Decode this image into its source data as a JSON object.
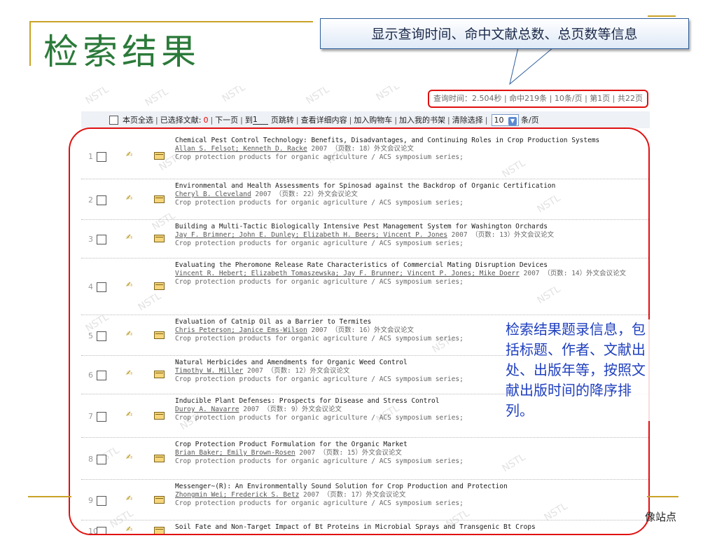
{
  "slide": {
    "title": "检索结果",
    "callout": "显示查询时间、命中文献总数、总页数等信息",
    "annotation": "检索结果题录信息，包括标题、作者、文献出处、出版年等，按照文献出版时间的降序排列。",
    "footer_fragment": "像站点",
    "accent_color": "#c9a227",
    "title_color": "#2b7a3a",
    "frame_color": "#e01010"
  },
  "status": {
    "query_time": "查询时间：2.504秒",
    "hits": "命中219条",
    "per_page": "10条/页",
    "current_page": "第1页",
    "total_pages": "共22页"
  },
  "toolbar": {
    "select_all": "本页全选",
    "selected_label": "已选择文献:",
    "selected_count": "0",
    "next_page": "下一页",
    "goto_prefix": "到",
    "goto_value": "1",
    "goto_suffix": "页跳转",
    "view_details": "查看详细内容",
    "add_cart": "加入购物车",
    "add_shelf": "加入我的书架",
    "clear_selection": "清除选择",
    "page_size": "10",
    "page_size_unit": "条/页"
  },
  "watermark": "NSTL",
  "results": [
    {
      "num": "1",
      "title": "Chemical Pest Control Technology: Benefits, Disadvantages, and Continuing Roles in Crop Production Systems",
      "authors": "Allan S. Felsot; Kenneth D. Racke",
      "year": "2007",
      "meta": "（页数: 18）外文会议论文",
      "source": "Crop protection products for organic agriculture / ACS symposium series;"
    },
    {
      "num": "2",
      "title": "Environmental and Health Assessments for Spinosad against the Backdrop of Organic Certification",
      "authors": "Cheryl B. Cleveland",
      "year": "2007",
      "meta": "（页数: 22）外文会议论文",
      "source": "Crop protection products for organic agriculture / ACS symposium series;"
    },
    {
      "num": "3",
      "title": "Building a Multi-Tactic Biologically Intensive Pest Management System for Washington Orchards",
      "authors": "Jay F. Brimner; John E. Dunley; Elizabeth H. Beers; Vincent P. Jones",
      "year": "2007",
      "meta": "（页数: 13）外文会议论文",
      "source": "Crop protection products for organic agriculture / ACS symposium series;"
    },
    {
      "num": "4",
      "title": "Evaluating the Pheromone Release Rate Characteristics of Commercial Mating Disruption Devices",
      "authors": "Vincent R. Hebert; Elizabeth Tomaszewska; Jay F. Brunner; Vincent P. Jones; Mike Doerr",
      "year": "2007",
      "meta": "（页数: 14）外文会议论文",
      "source": "Crop protection products for organic agriculture / ACS symposium series;"
    },
    {
      "num": "5",
      "title": "Evaluation of Catnip Oil as a Barrier to Termites",
      "authors": "Chris Peterson; Janice Ems-Wilson",
      "year": "2007",
      "meta": "（页数: 16）外文会议论文",
      "source": "Crop protection products for organic agriculture / ACS symposium series;"
    },
    {
      "num": "6",
      "title": "Natural Herbicides and Amendments for Organic Weed Control",
      "authors": "Timothy W. Miller",
      "year": "2007",
      "meta": "（页数: 12）外文会议论文",
      "source": "Crop protection products for organic agriculture / ACS symposium series;"
    },
    {
      "num": "7",
      "title": "Inducible Plant Defenses: Prospects for Disease and Stress Control",
      "authors": "Duroy A. Navarre",
      "year": "2007",
      "meta": "（页数: 9）外文会议论文",
      "source": "Crop protection products for organic agriculture / ACS symposium series;"
    },
    {
      "num": "8",
      "title": "Crop Protection Product Formulation for the Organic Market",
      "authors": "Brian Baker; Emily Brown-Rosen",
      "year": "2007",
      "meta": "（页数: 15）外文会议论文",
      "source": "Crop protection products for organic agriculture / ACS symposium series;"
    },
    {
      "num": "9",
      "title": "Messenger~(R): An Environmentally Sound Solution for Crop Production and Protection",
      "authors": "Zhongmin Wei; Frederick S. Betz",
      "year": "2007",
      "meta": "（页数: 17）外文会议论文",
      "source": "Crop protection products for organic agriculture / ACS symposium series;"
    },
    {
      "num": "10",
      "title": "Soil Fate and Non-Target Impact of Bt Proteins in Microbial Sprays and Transgenic Bt Crops",
      "authors": "",
      "year": "",
      "meta": "",
      "source": ""
    }
  ]
}
